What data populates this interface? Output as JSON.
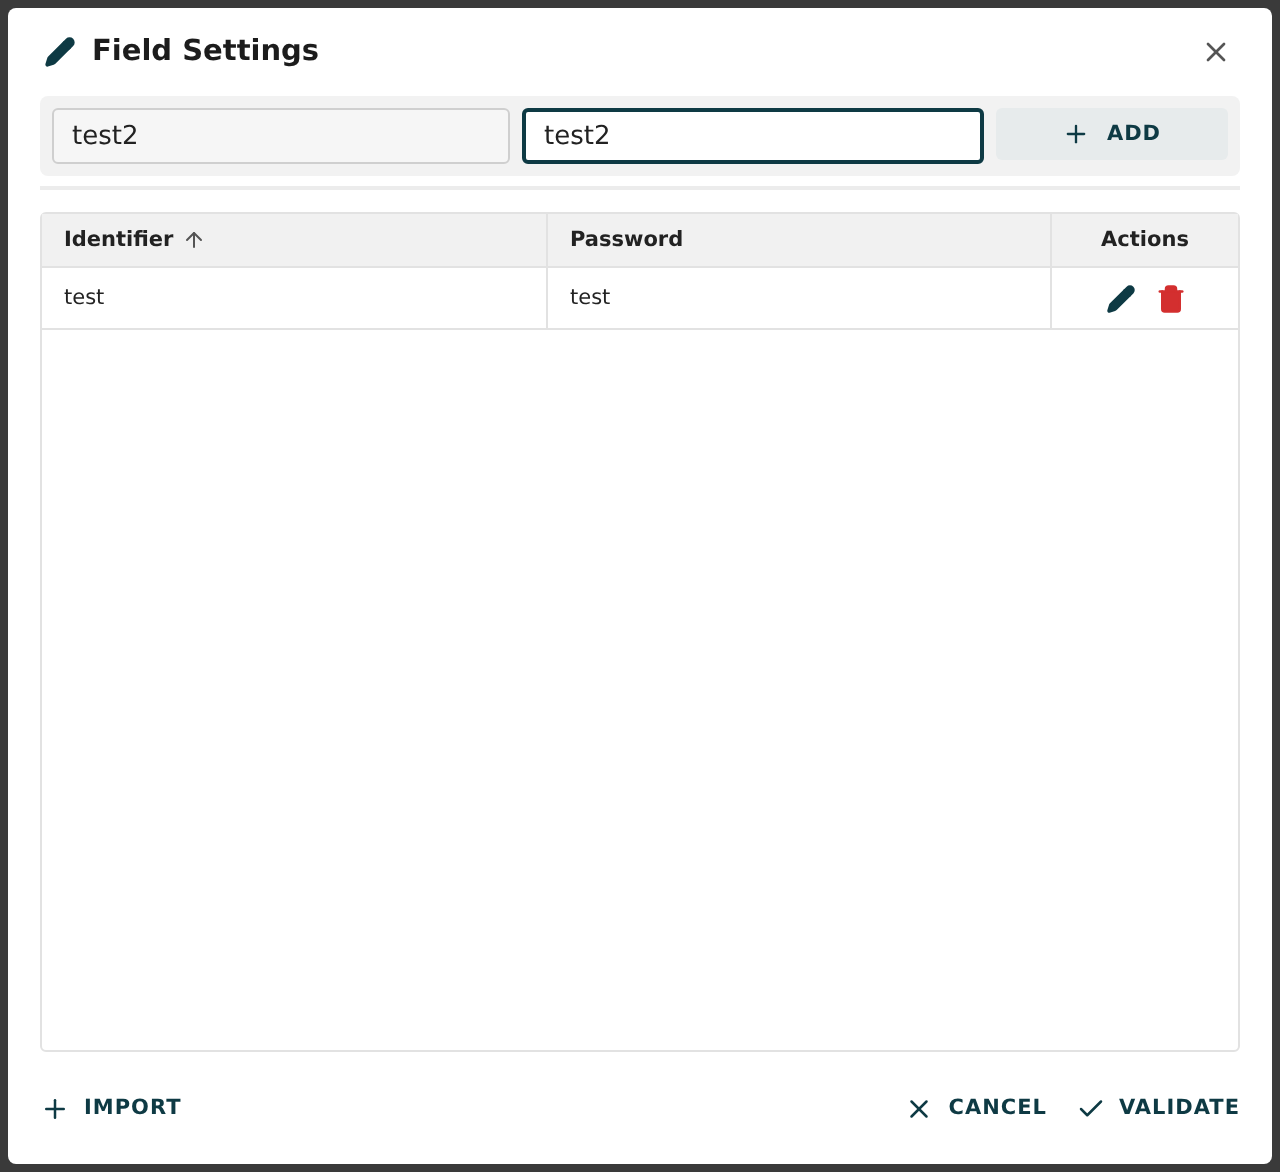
{
  "dialog": {
    "title": "Field Settings"
  },
  "form": {
    "fields": [
      {
        "value": "test2",
        "focused": false
      },
      {
        "value": "test2",
        "focused": true
      }
    ],
    "add_button": "ADD"
  },
  "table": {
    "columns": [
      {
        "label": "Identifier",
        "sorted": true
      },
      {
        "label": "Password",
        "sorted": false
      },
      {
        "label": "Actions",
        "sorted": false
      }
    ],
    "rows": [
      {
        "identifier": "test",
        "password": "test"
      }
    ]
  },
  "footer": {
    "import_button": "IMPORT",
    "cancel_button": "CANCEL",
    "validate_button": "VALIDATE"
  }
}
